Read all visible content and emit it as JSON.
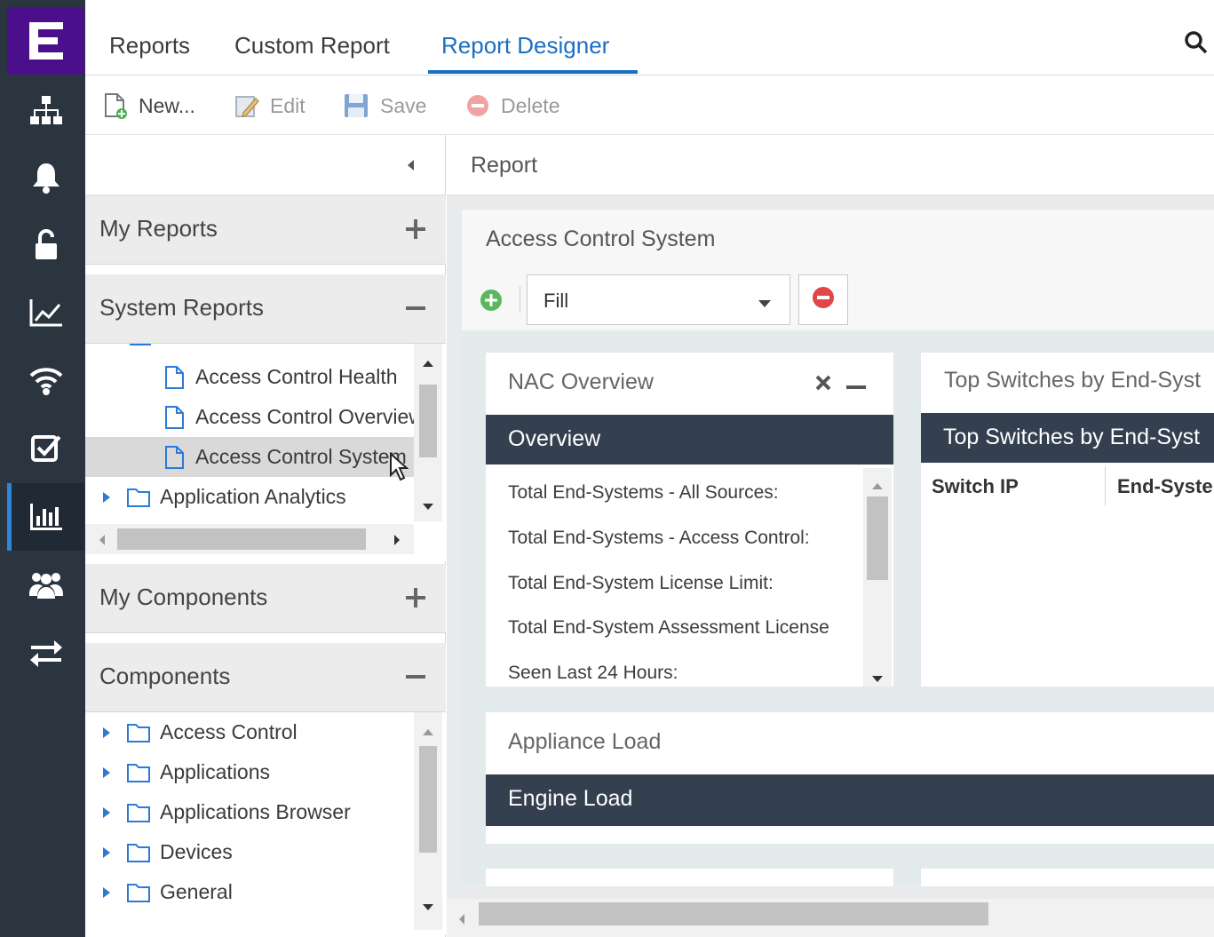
{
  "app": {
    "nav_items": [
      {
        "icon": "network-topology-icon"
      },
      {
        "icon": "bell-icon"
      },
      {
        "icon": "unlock-icon"
      },
      {
        "icon": "line-chart-icon"
      },
      {
        "icon": "wifi-icon"
      },
      {
        "icon": "checkbox-icon"
      },
      {
        "icon": "bar-chart-icon",
        "active": true
      },
      {
        "icon": "users-icon"
      },
      {
        "icon": "swap-arrows-icon"
      }
    ]
  },
  "tabs": [
    {
      "label": "Reports"
    },
    {
      "label": "Custom Report"
    },
    {
      "label": "Report Designer",
      "active": true
    }
  ],
  "toolbar": {
    "new_label": "New...",
    "edit_label": "Edit",
    "save_label": "Save",
    "delete_label": "Delete"
  },
  "left_panel": {
    "my_reports": {
      "label": "My Reports",
      "action": "+"
    },
    "system_reports": {
      "label": "System Reports",
      "action": "−",
      "items": [
        {
          "label": "Access Control Health",
          "type": "file"
        },
        {
          "label": "Access Control Overview",
          "type": "file"
        },
        {
          "label": "Access Control System",
          "type": "file",
          "selected": true
        },
        {
          "label": "Application Analytics",
          "type": "folder"
        }
      ]
    },
    "my_components": {
      "label": "My Components",
      "action": "+"
    },
    "components": {
      "label": "Components",
      "action": "−",
      "items": [
        {
          "label": "Access Control"
        },
        {
          "label": "Applications"
        },
        {
          "label": "Applications Browser"
        },
        {
          "label": "Devices"
        },
        {
          "label": "General"
        }
      ]
    }
  },
  "report": {
    "header": "Report",
    "title": "Access Control System",
    "fill_select": "Fill",
    "widgets": {
      "nac": {
        "title": "NAC Overview",
        "bar": "Overview",
        "rows": [
          "Total End-Systems - All Sources:",
          "Total End-Systems - Access Control:",
          "Total End-System License Limit:",
          "Total End-System Assessment License",
          "Seen Last 24 Hours:"
        ]
      },
      "top_switches": {
        "title": "Top Switches by End-Syst",
        "bar": "Top Switches by End-Syst",
        "columns": [
          "Switch IP",
          "End-Syste"
        ]
      },
      "appliance": {
        "title": "Appliance Load",
        "bar": "Engine Load"
      }
    }
  },
  "colors": {
    "nav_bg": "#2b3540",
    "logo_bg": "#4b0f8c",
    "accent": "#1a6fc4",
    "widget_bar": "#34404f"
  }
}
